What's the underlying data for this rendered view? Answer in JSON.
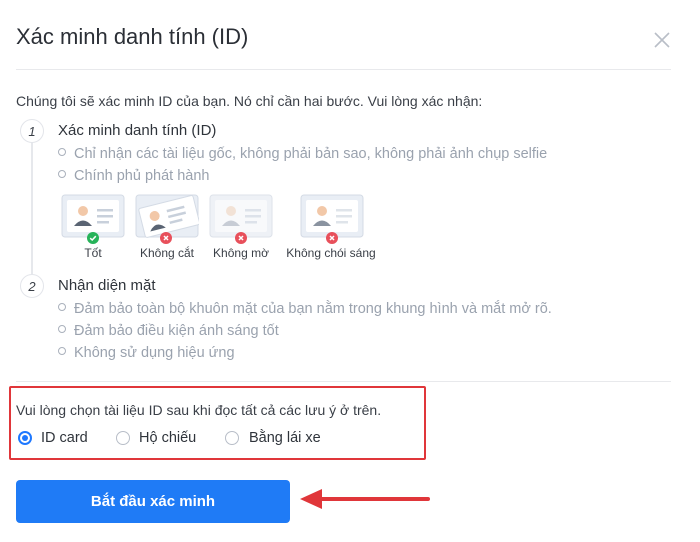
{
  "dialog": {
    "title": "Xác minh danh tính (ID)",
    "close_icon": "close-icon"
  },
  "intro": "Chúng tôi sẽ xác minh ID của bạn. Nó chỉ cần hai bước. Vui lòng xác nhận:",
  "steps": [
    {
      "number": "1",
      "title": "Xác minh danh tính (ID)",
      "bullets": [
        "Chỉ nhận các tài liệu gốc, không phải bản sao, không phải ảnh chụp selfie",
        "Chính phủ phát hành"
      ],
      "examples": [
        {
          "label": "Tốt",
          "status": "ok",
          "icon": "id-card-good-icon"
        },
        {
          "label": "Không cắt",
          "status": "bad",
          "icon": "id-card-cropped-icon"
        },
        {
          "label": "Không mờ",
          "status": "bad",
          "icon": "id-card-blurry-icon"
        },
        {
          "label": "Không chói sáng",
          "status": "bad",
          "icon": "id-card-glare-icon"
        }
      ]
    },
    {
      "number": "2",
      "title": "Nhận diện mặt",
      "bullets": [
        "Đảm bảo toàn bộ khuôn mặt của bạn nằm trong khung hình và mắt mở rõ.",
        "Đảm bảo điều kiện ánh sáng tốt",
        "Không sử dụng hiệu ứng"
      ]
    }
  ],
  "document_select": {
    "prompt": "Vui lòng chọn tài liệu ID sau khi đọc tất cả các lưu ý ở trên.",
    "options": [
      {
        "label": "ID card",
        "selected": true
      },
      {
        "label": "Hộ chiếu",
        "selected": false
      },
      {
        "label": "Bằng lái xe",
        "selected": false
      }
    ]
  },
  "start_button": "Bắt đầu xác minh",
  "colors": {
    "accent": "#1f7bf6",
    "highlight_border": "#e0363a",
    "ok": "#27b35a",
    "bad": "#e8505b"
  }
}
